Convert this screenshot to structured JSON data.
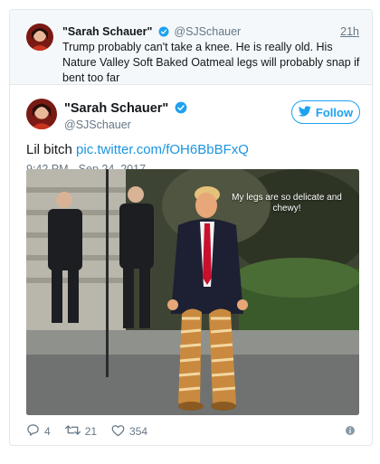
{
  "quoted_tweet": {
    "author_name": "\"Sarah Schauer\"",
    "author_handle": "@SJSchauer",
    "time": "21h",
    "text": "Trump probably can't take a knee. He is really old. His Nature Valley Soft Baked Oatmeal legs will probably snap if bent too far"
  },
  "tweet": {
    "author_name": "\"Sarah Schauer\"",
    "author_handle": "@SJSchauer",
    "follow_label": "Follow",
    "text": "Lil bitch",
    "link_text": "pic.twitter.com/fOH6BbBFxQ",
    "timestamp": "9:42 PM - Sep 24, 2017",
    "media_caption": "My legs are so delicate and chewy!"
  },
  "actions": {
    "replies": "4",
    "retweets": "21",
    "likes": "354"
  },
  "colors": {
    "twitter_blue": "#1da1f2",
    "link_blue": "#1b95e0",
    "muted_gray": "#657786",
    "border": "#e1e8ed"
  },
  "icons": [
    "verified-badge-icon",
    "twitter-bird-icon",
    "reply-icon",
    "retweet-icon",
    "like-icon",
    "info-icon"
  ]
}
